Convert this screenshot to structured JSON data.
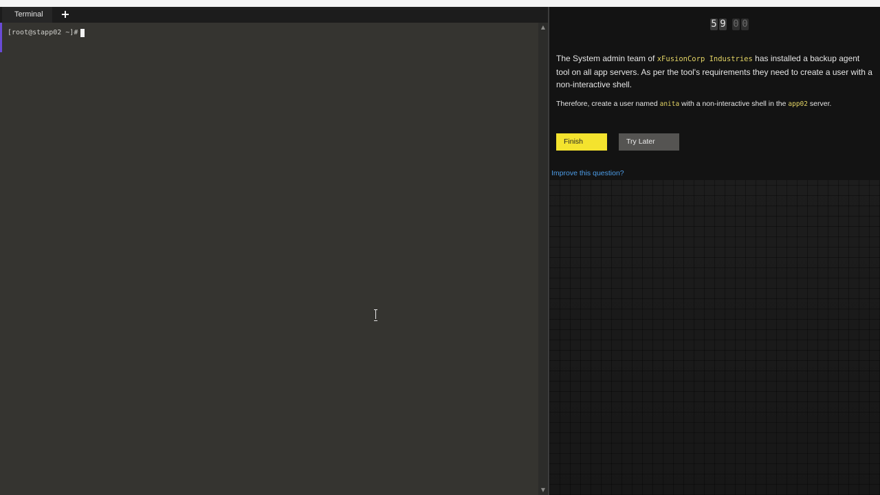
{
  "terminal": {
    "tab_label": "Terminal",
    "add_tab_glyph": "+",
    "prompt": "[root@stapp02 ~]#",
    "scroll_up_glyph": "▲",
    "scroll_down_glyph": "▼"
  },
  "question": {
    "timer": {
      "minutes": [
        "5",
        "9"
      ],
      "seconds": [
        "0",
        "0"
      ]
    },
    "paragraph_1": {
      "before": "The System admin team of ",
      "company": "xFusionCorp Industries",
      "after": " has installed a backup agent tool on all app servers. As per the tool's requirements they need to create a user with a non-interactive shell."
    },
    "paragraph_2": {
      "before": "Therefore, create a user named ",
      "user": "anita",
      "middle": " with a non-interactive shell in the ",
      "server": "app02",
      "after": " server."
    },
    "finish_label": "Finish",
    "try_later_label": "Try Later",
    "improve_link": "Improve this question?"
  },
  "colors": {
    "finish_button": "#f4e32e",
    "try_later_button": "#555452",
    "link": "#4d9de8",
    "code_highlight": "#e4d565",
    "terminal_bg": "#353430",
    "tab_accent": "#6a4bd6"
  },
  "icons": {
    "add_tab": "plus-icon",
    "text_cursor": "text-cursor-icon"
  }
}
